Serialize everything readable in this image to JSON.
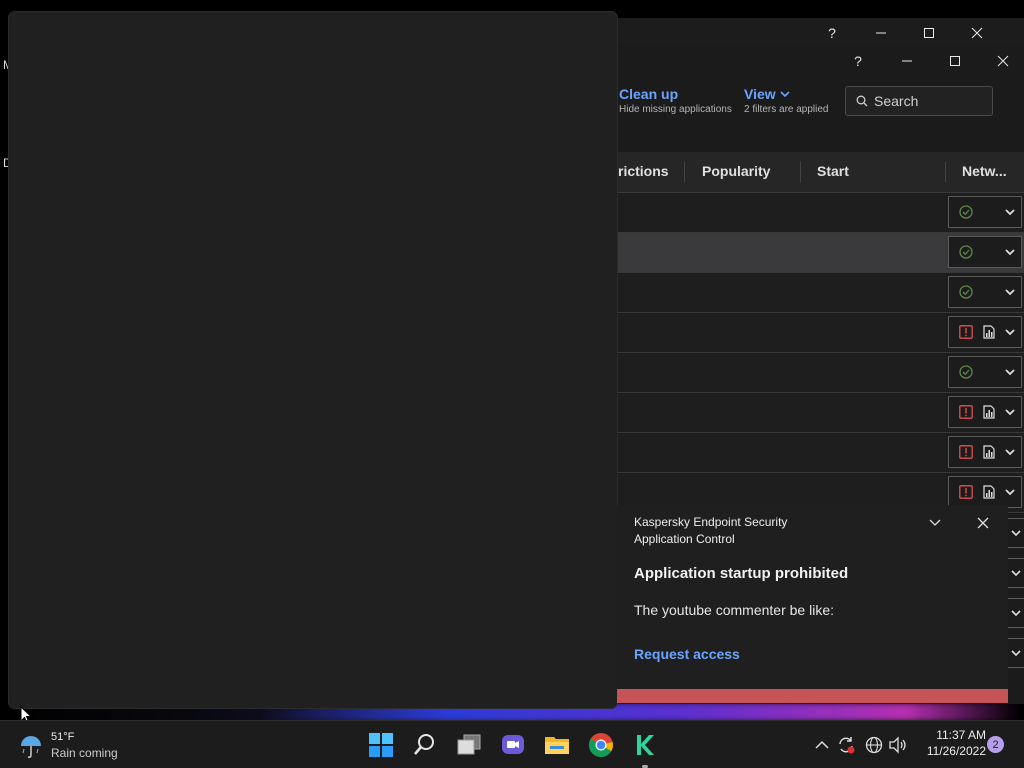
{
  "desktop": {
    "edge_letters": [
      "M",
      "D"
    ]
  },
  "window_controls": {
    "help": "?",
    "minimize": "—",
    "maximize": "☐",
    "close": "✕"
  },
  "toolbar": {
    "cleanup_label": "Clean up",
    "cleanup_sub": "Hide missing applications",
    "view_label": "View",
    "view_sub": "2 filters are applied",
    "search_placeholder": "Search"
  },
  "grid": {
    "columns": [
      "rictions",
      "Popularity",
      "Start",
      "Netw..."
    ],
    "rows": [
      {
        "status": "ok"
      },
      {
        "status": "ok",
        "selected": true
      },
      {
        "status": "ok"
      },
      {
        "status": "warning"
      },
      {
        "status": "ok"
      },
      {
        "status": "warning"
      },
      {
        "status": "warning"
      },
      {
        "status": "warning"
      }
    ]
  },
  "notification": {
    "app_name": "Kaspersky Endpoint Security",
    "component": "Application Control",
    "title": "Application startup prohibited",
    "message": "The youtube commenter be like:",
    "action": "Request access"
  },
  "taskbar": {
    "weather_temp": "51°F",
    "weather_desc": "Rain coming",
    "time": "11:37 AM",
    "date": "11/26/2022",
    "notification_count": "2",
    "pinned_apps": [
      "start-icon",
      "search-icon",
      "task-view-icon",
      "chat-icon",
      "file-explorer-icon",
      "chrome-icon",
      "kaspersky-icon"
    ]
  },
  "colors": {
    "accent_link": "#6aa4ff",
    "ok_green": "#5a8a4a",
    "warn_red": "#e05050",
    "toast_bar": "#c75454"
  }
}
